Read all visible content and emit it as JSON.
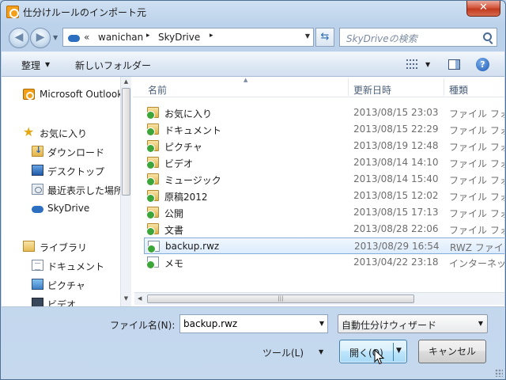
{
  "window": {
    "title": "仕分けルールのインポート元",
    "close_glyph": "✕"
  },
  "address": {
    "chevron": "«",
    "segments": [
      "wanichan",
      "SkyDrive"
    ],
    "separator": "▸"
  },
  "search": {
    "placeholder": "SkyDriveの検索"
  },
  "toolbar": {
    "organize_label": "整理",
    "new_folder_label": "新しいフォルダー"
  },
  "sidebar": {
    "items": [
      {
        "label": "Microsoft Outlook",
        "icon": "outlook-icon"
      },
      {
        "label": "お気に入り",
        "icon": "star-icon"
      },
      {
        "label": "ダウンロード",
        "icon": "downloads-folder-icon"
      },
      {
        "label": "デスクトップ",
        "icon": "desktop-icon"
      },
      {
        "label": "最近表示した場所",
        "icon": "recent-places-icon"
      },
      {
        "label": "SkyDrive",
        "icon": "skydrive-cloud-icon"
      },
      {
        "label": "ライブラリ",
        "icon": "library-icon"
      },
      {
        "label": "ドキュメント",
        "icon": "documents-icon"
      },
      {
        "label": "ピクチャ",
        "icon": "pictures-icon"
      },
      {
        "label": "ビデオ",
        "icon": "videos-icon"
      }
    ]
  },
  "filelist": {
    "columns": {
      "name": "名前",
      "date": "更新日時",
      "type": "種類"
    },
    "rows": [
      {
        "name": "お気に入り",
        "date": "2013/08/15 23:03",
        "type": "ファイル フォルダー",
        "kind": "folder"
      },
      {
        "name": "ドキュメント",
        "date": "2013/08/15 22:29",
        "type": "ファイル フォルダー",
        "kind": "folder"
      },
      {
        "name": "ピクチャ",
        "date": "2013/08/19 12:48",
        "type": "ファイル フォルダー",
        "kind": "folder"
      },
      {
        "name": "ビデオ",
        "date": "2013/08/14 14:10",
        "type": "ファイル フォルダー",
        "kind": "folder"
      },
      {
        "name": "ミュージック",
        "date": "2013/08/14 15:40",
        "type": "ファイル フォルダー",
        "kind": "folder"
      },
      {
        "name": "原稿2012",
        "date": "2013/08/15 12:02",
        "type": "ファイル フォルダー",
        "kind": "folder"
      },
      {
        "name": "公開",
        "date": "2013/08/15 17:13",
        "type": "ファイル フォルダー",
        "kind": "folder"
      },
      {
        "name": "文書",
        "date": "2013/08/28 22:06",
        "type": "ファイル フォルダー",
        "kind": "folder"
      },
      {
        "name": "backup.rwz",
        "date": "2013/08/29 16:54",
        "type": "RWZ ファイル",
        "kind": "file",
        "selected": true
      },
      {
        "name": "メモ",
        "date": "2013/04/22 23:18",
        "type": "インターネット ショートカット",
        "kind": "file"
      }
    ]
  },
  "footer": {
    "filename_label": "ファイル名(N):",
    "filename_value": "backup.rwz",
    "filter_value": "自動仕分けウィザード",
    "tools_label": "ツール(L)",
    "open_label": "開く(O)",
    "cancel_label": "キャンセル"
  }
}
